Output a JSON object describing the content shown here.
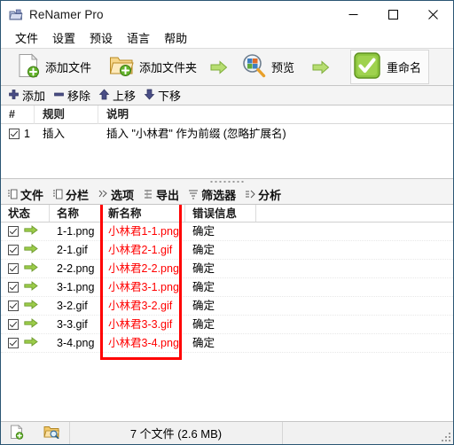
{
  "window": {
    "title": "ReNamer Pro",
    "app_icon": "folder-app-icon",
    "minimize_label": "–",
    "maximize_label": "□",
    "close_label": "✕"
  },
  "menu": {
    "items": [
      {
        "label": "文件",
        "name": "menu-file"
      },
      {
        "label": "设置",
        "name": "menu-settings"
      },
      {
        "label": "预设",
        "name": "menu-presets"
      },
      {
        "label": "语言",
        "name": "menu-language"
      },
      {
        "label": "帮助",
        "name": "menu-help"
      }
    ]
  },
  "toolbar": {
    "add_files": {
      "label": "添加文件",
      "icon": "add-file-icon"
    },
    "add_folder": {
      "label": "添加文件夹",
      "icon": "add-folder-icon"
    },
    "arrow1": "arrow-right-icon",
    "preview": {
      "label": "预览",
      "icon": "preview-magnifier-icon"
    },
    "arrow2": "arrow-right-icon",
    "rename": {
      "label": "重命名",
      "icon": "green-check-icon"
    }
  },
  "rules_toolbar": {
    "add": {
      "label": "添加",
      "icon": "plus-icon"
    },
    "remove": {
      "label": "移除",
      "icon": "minus-icon"
    },
    "move_up": {
      "label": "上移",
      "icon": "arrow-up-icon"
    },
    "move_down": {
      "label": "下移",
      "icon": "arrow-down-icon"
    }
  },
  "rules_grid": {
    "columns": [
      "#",
      "规则",
      "说明"
    ],
    "rows": [
      {
        "checked": true,
        "index": "1",
        "rule": "插入",
        "description": "插入 \"小林君\" 作为前缀 (忽略扩展名)"
      }
    ]
  },
  "tabs": [
    {
      "label": "文件",
      "icon": "list-file-icon",
      "active": true
    },
    {
      "label": "分栏",
      "icon": "list-columns-icon",
      "active": false
    },
    {
      "label": "选项",
      "icon": "options-icon",
      "active": false
    },
    {
      "label": "导出",
      "icon": "export-icon",
      "active": false
    },
    {
      "label": "筛选器",
      "icon": "filter-icon",
      "active": false
    },
    {
      "label": "分析",
      "icon": "analyze-icon",
      "active": false
    }
  ],
  "file_list": {
    "columns": [
      "状态",
      "名称",
      "新名称",
      "错误信息"
    ],
    "rows": [
      {
        "checked": true,
        "status_icon": "green-arrow-icon",
        "name": "1-1.png",
        "new_name": "小林君1-1.png",
        "error": "确定"
      },
      {
        "checked": true,
        "status_icon": "green-arrow-icon",
        "name": "2-1.gif",
        "new_name": "小林君2-1.gif",
        "error": "确定"
      },
      {
        "checked": true,
        "status_icon": "green-arrow-icon",
        "name": "2-2.png",
        "new_name": "小林君2-2.png",
        "error": "确定"
      },
      {
        "checked": true,
        "status_icon": "green-arrow-icon",
        "name": "3-1.png",
        "new_name": "小林君3-1.png",
        "error": "确定"
      },
      {
        "checked": true,
        "status_icon": "green-arrow-icon",
        "name": "3-2.gif",
        "new_name": "小林君3-2.gif",
        "error": "确定"
      },
      {
        "checked": true,
        "status_icon": "green-arrow-icon",
        "name": "3-3.gif",
        "new_name": "小林君3-3.gif",
        "error": "确定"
      },
      {
        "checked": true,
        "status_icon": "green-arrow-icon",
        "name": "3-4.png",
        "new_name": "小林君3-4.png",
        "error": "确定"
      }
    ]
  },
  "annotation": {
    "color": "#ff0000",
    "target_column": "新名称"
  },
  "statusbar": {
    "add_file_icon": "add-file-small-icon",
    "browse_icon": "folder-search-small-icon",
    "summary": "7 个文件 (2.6 MB)"
  },
  "colors": {
    "window_border": "#2b5673",
    "toolbar_bg": "#f4f4f4",
    "highlight_red": "#ff0000",
    "green_arrow": "#8cc63f",
    "rename_green": "#76b82a"
  }
}
